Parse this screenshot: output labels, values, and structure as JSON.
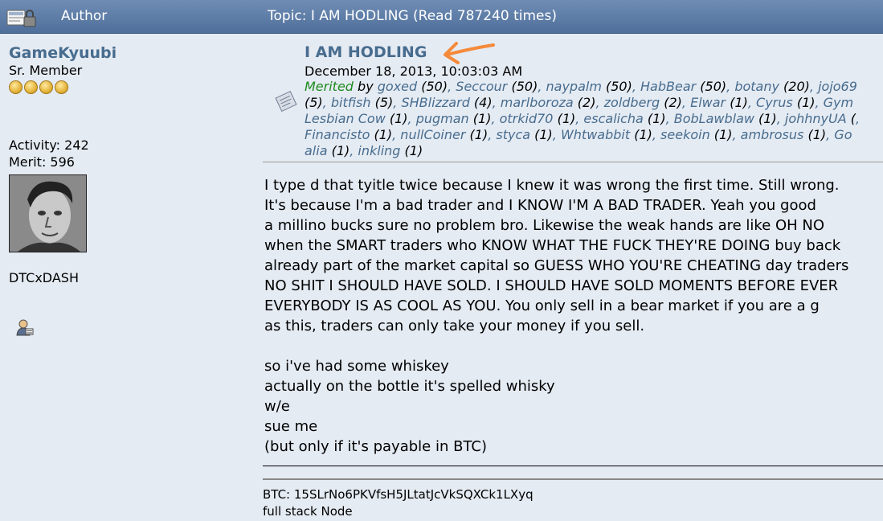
{
  "header": {
    "lock_icon": "topic-locked-icon",
    "author_col": "Author",
    "topic_text": "Topic: I AM HODLING  (Read 787240 times)"
  },
  "poster": {
    "name": "GameKyuubi",
    "rank": "Sr. Member",
    "stars": 4,
    "activity": "Activity: 242",
    "merit": "Merit: 596",
    "personal_text": "DTCxDASH",
    "profile_icon": "profile-person-icon"
  },
  "post": {
    "title": "I AM HODLING",
    "date": "December 18, 2013, 10:03:03 AM",
    "merited_label": "Merited",
    "merited_by": "by",
    "merits": [
      {
        "n": "goxed",
        "c": "(50)"
      },
      {
        "n": "Seccour",
        "c": "(50)"
      },
      {
        "n": "naypalm",
        "c": "(50)"
      },
      {
        "n": "HabBear",
        "c": "(50)"
      },
      {
        "n": "botany",
        "c": "(20)"
      },
      {
        "n": "jojo69",
        "c": ""
      },
      {
        "n": "",
        "c": "(5)"
      },
      {
        "n": "bitfish",
        "c": "(5)"
      },
      {
        "n": "SHBlizzard",
        "c": "(4)"
      },
      {
        "n": "marlboroza",
        "c": "(2)"
      },
      {
        "n": "zoldberg",
        "c": "(2)"
      },
      {
        "n": "Elwar",
        "c": "(1)"
      },
      {
        "n": "Cyrus",
        "c": "(1)"
      },
      {
        "n": "Gym",
        "c": ""
      },
      {
        "n": "Lesbian Cow",
        "c": "(1)"
      },
      {
        "n": "pugman",
        "c": "(1)"
      },
      {
        "n": "otrkid70",
        "c": "(1)"
      },
      {
        "n": "escalicha",
        "c": "(1)"
      },
      {
        "n": "BobLawblaw",
        "c": "(1)"
      },
      {
        "n": "johhnyUA",
        "c": "("
      },
      {
        "n": "Financisto",
        "c": "(1)"
      },
      {
        "n": "nullCoiner",
        "c": "(1)"
      },
      {
        "n": "styca",
        "c": "(1)"
      },
      {
        "n": "Whtwabbit",
        "c": "(1)"
      },
      {
        "n": "seekoin",
        "c": "(1)"
      },
      {
        "n": "ambrosus",
        "c": "(1)"
      },
      {
        "n": "Go",
        "c": ""
      },
      {
        "n": "alia",
        "c": "(1)"
      },
      {
        "n": "inkling",
        "c": "(1)"
      }
    ],
    "body_lines": [
      "I type d that tyitle twice because I knew it was wrong the first time.  Still wrong.",
      "It's because I'm a bad trader and I KNOW I'M A BAD TRADER.  Yeah you good",
      "a millino bucks sure no problem bro.  Likewise the weak hands are like OH NO",
      "when the SMART traders who KNOW WHAT THE FUCK THEY'RE DOING buy back",
      "already part of the market capital so GUESS WHO YOU'RE CHEATING day traders",
      "NO SHIT I SHOULD HAVE SOLD.  I SHOULD HAVE SOLD MOMENTS BEFORE EVER",
      "EVERYBODY IS AS COOL AS YOU.  You only sell in a bear market if you are a g",
      "as this, traders can only take your money if you sell.",
      "",
      "so i've had some whiskey",
      "actually on the bottle it's spelled whisky",
      "w/e",
      "sue me",
      "(but only if it's payable in BTC)"
    ],
    "signature": [
      "BTC: 15SLrNo6PKVfsH5JLtatJcVkSQXCk1LXyq",
      "full stack Node"
    ]
  },
  "colors": {
    "header_bg": "#5a79a5",
    "bg": "#e5ebf3",
    "link": "#476c8e",
    "merited": "#1e8b1e",
    "arrow": "#f58a3b"
  }
}
